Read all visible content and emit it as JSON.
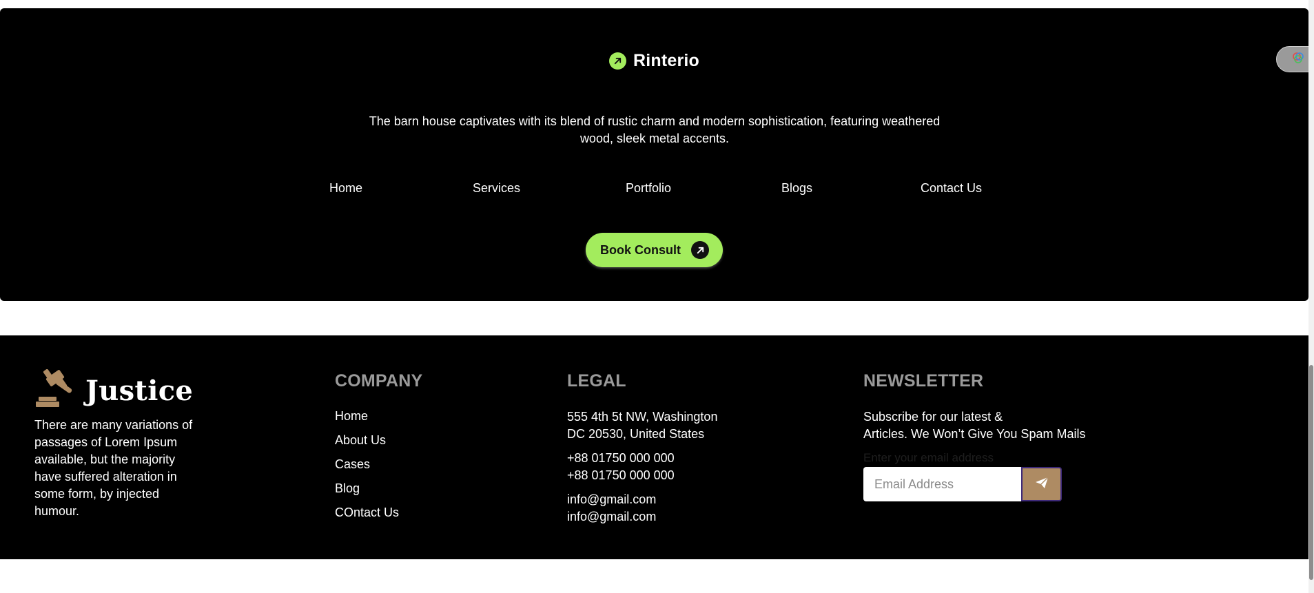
{
  "rinterio": {
    "brand_name": "Rinterio",
    "description": "The barn house captivates with its blend of rustic charm and modern sophistication, featuring weathered wood, sleek metal accents.",
    "nav": [
      "Home",
      "Services",
      "Portfolio",
      "Blogs",
      "Contact Us"
    ],
    "cta_label": "Book Consult",
    "accent_color": "#a3ec5d",
    "icons": {
      "logo": "arrow-up-right-icon",
      "cta": "arrow-up-right-icon"
    }
  },
  "footer": {
    "brand": {
      "name": "Justice",
      "logo_icon": "gavel-icon",
      "description": "There are many variations of passages of Lorem Ipsum available, but the majority have suffered alteration in some form, by injected humour.",
      "accent_color": "#ae8b63"
    },
    "company": {
      "title": "COMPANY",
      "links": [
        "Home",
        "About Us",
        "Cases",
        "Blog",
        "COntact Us"
      ]
    },
    "legal": {
      "title": "LEGAL",
      "address_line1": "555 4th 5t NW, Washington",
      "address_line2": "DC 20530, United States",
      "phone1": "+88 01750 000 000",
      "phone2": "+88 01750 000 000",
      "email1": "info@gmail.com",
      "email2": "info@gmail.com"
    },
    "newsletter": {
      "title": "NEWSLETTER",
      "text_line1": "Subscribe for our latest &",
      "text_line2": "Articles. We Won’t Give You Spam Mails",
      "hint": "Enter your email address",
      "input_placeholder": "Email Address",
      "input_value": "",
      "submit_icon": "paper-plane-icon"
    }
  }
}
